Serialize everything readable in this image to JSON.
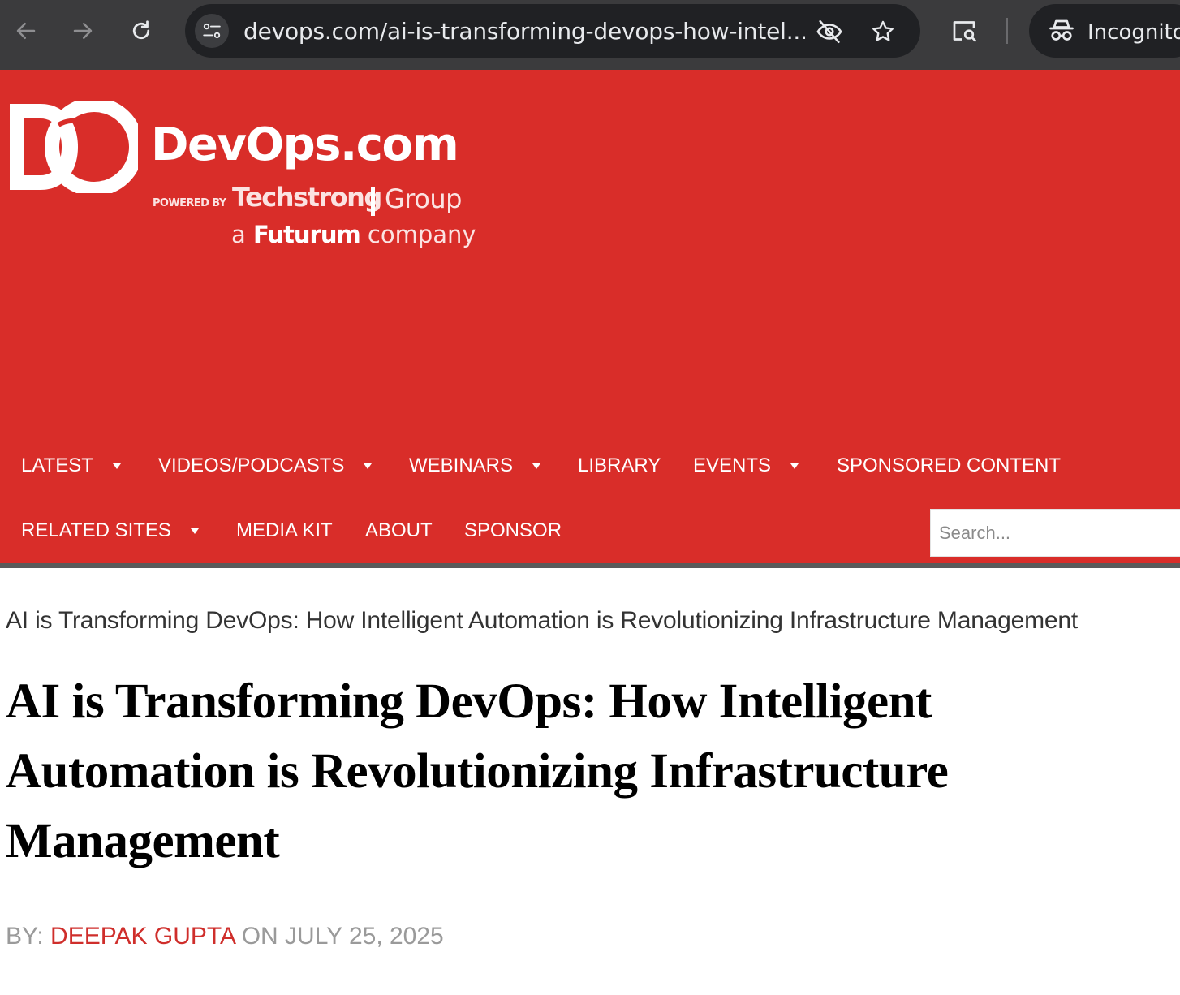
{
  "browser": {
    "url": "devops.com/ai-is-transforming-devops-how-intel...",
    "incognito_label": "Incognito"
  },
  "header": {
    "brand": "DevOps.com",
    "powered_by": "POWERED BY",
    "techstrong": "Techstrong",
    "group": "Group",
    "futurum_prefix": "a",
    "futurum": "Futurum",
    "futurum_suffix": "company",
    "accent_color": "#d92d29"
  },
  "nav": {
    "row1": [
      {
        "label": "LATEST",
        "dropdown": true
      },
      {
        "label": "VIDEOS/PODCASTS",
        "dropdown": true
      },
      {
        "label": "WEBINARS",
        "dropdown": true
      },
      {
        "label": "LIBRARY",
        "dropdown": false
      },
      {
        "label": "EVENTS",
        "dropdown": true
      },
      {
        "label": "SPONSORED CONTENT",
        "dropdown": false
      }
    ],
    "row2": [
      {
        "label": "RELATED SITES",
        "dropdown": true
      },
      {
        "label": "MEDIA KIT",
        "dropdown": false
      },
      {
        "label": "ABOUT",
        "dropdown": false
      },
      {
        "label": "SPONSOR",
        "dropdown": false
      }
    ]
  },
  "search": {
    "placeholder": "Search..."
  },
  "article": {
    "breadcrumb": "AI is Transforming DevOps: How Intelligent Automation is Revolutionizing Infrastructure Management",
    "title": "AI is Transforming DevOps: How Intelligent Automation is Revolutionizing Infrastructure Management",
    "by_label": "BY:",
    "author": "DEEPAK GUPTA",
    "on_label": "ON",
    "date": "JULY 25, 2025"
  }
}
